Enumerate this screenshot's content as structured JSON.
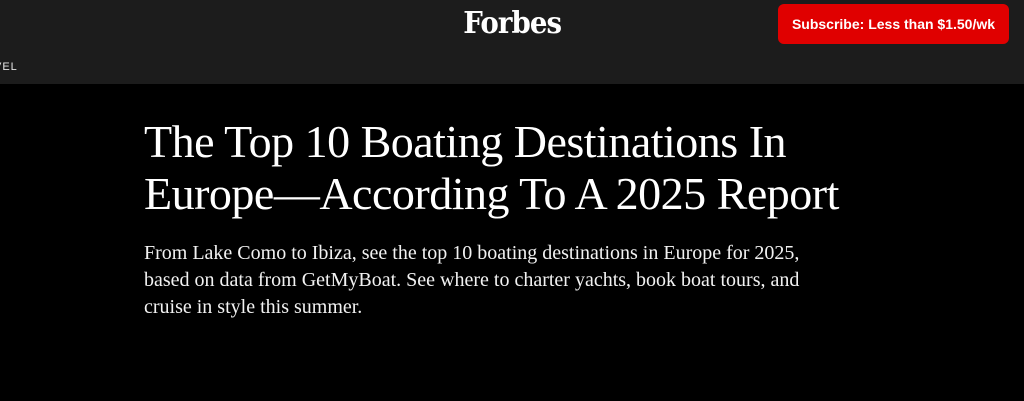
{
  "header": {
    "logo": "Forbes",
    "subscribe_label": "Subscribe: Less than $1.50/wk",
    "section_label": "VEL"
  },
  "article": {
    "headline": "The Top 10 Boating Destinations In Europe—According To A 2025 Report",
    "dek": "From Lake Como to Ibiza, see the top 10 boating destinations in Europe for 2025, based on data from GetMyBoat. See where to charter yachts, book boat tours, and cruise in style this summer."
  },
  "colors": {
    "background": "#000000",
    "header_bg": "#1c1c1c",
    "accent": "#e00000"
  }
}
